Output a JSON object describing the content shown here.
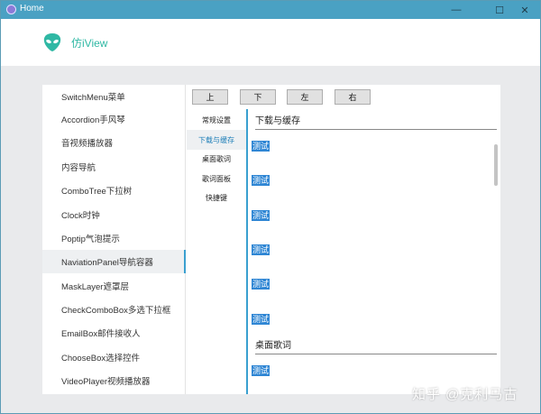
{
  "window": {
    "title": "Home",
    "controls": [
      "—",
      "☐",
      "✕"
    ]
  },
  "header": {
    "brand": "仿iView",
    "logo": "alien-logo-icon"
  },
  "menu": {
    "active_index": 7,
    "items": [
      "SwitchMenu菜单",
      "Accordion手风琴",
      "音视频播放器",
      "内容导航",
      "ComboTree下拉树",
      "Clock时钟",
      "Poptip气泡提示",
      "NaviationPanel导航容器",
      "MaskLayer遮罩层",
      "CheckComboBox多选下拉框",
      "EmailBox邮件接收人",
      "ChooseBox选择控件",
      "VideoPlayer视频播放器"
    ]
  },
  "toolbar": {
    "up": "上",
    "down": "下",
    "left": "左",
    "right": "右"
  },
  "subnav": {
    "active_index": 1,
    "items": [
      "常规设置",
      "下载与缓存",
      "桌面歌词",
      "歌词面板",
      "快捷键"
    ]
  },
  "content": {
    "section1_title": "下载与缓存",
    "section2_title": "桌面歌词",
    "test_label": "测试"
  },
  "watermark": "知乎 @克利马古",
  "colors": {
    "titlebar": "#4aa1c3",
    "accent": "#3aa0d0",
    "brand": "#2fb8a4",
    "highlight": "#2f86d4"
  }
}
